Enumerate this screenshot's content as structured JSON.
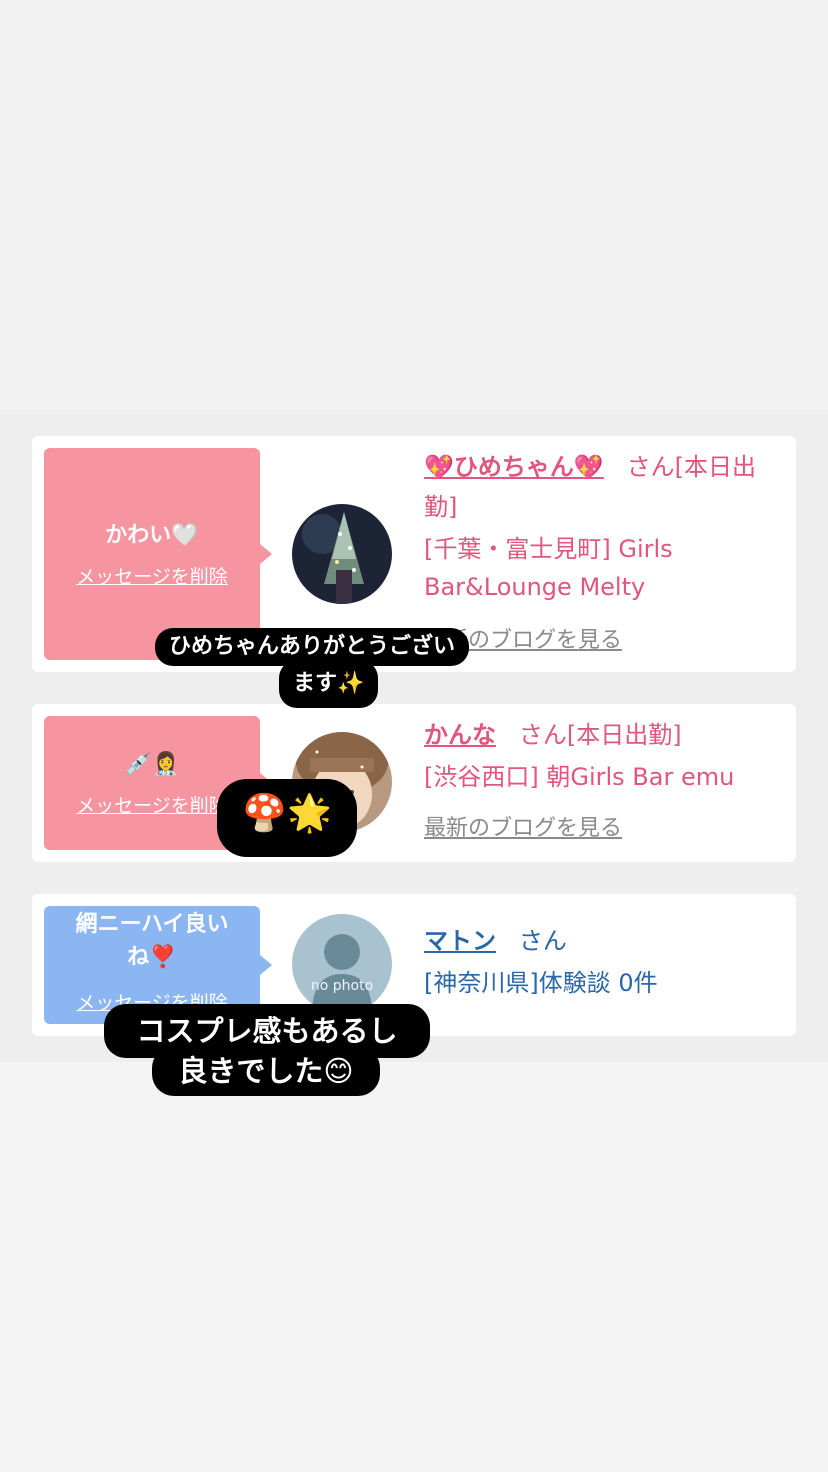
{
  "messages": [
    {
      "bubble_text": "かわい🤍",
      "delete_label": "メッセージを削除",
      "name": "💖ひめちゃん💖",
      "san": "さん[本日出",
      "san2": "勤]",
      "shop_line1": "[千葉・富士見町] Girls",
      "shop_line2": "Bar&Lounge Melty",
      "blog_link": "最新のブログを見る",
      "color": "#f6949f"
    },
    {
      "bubble_text": "💉👩‍⚕️",
      "delete_label": "メッセージを削除",
      "name": "かんな",
      "san": "さん[本日出勤]",
      "shop_line1": "[渋谷西口] 朝Girls Bar emu",
      "blog_link": "最新のブログを見る",
      "color": "#f6949f"
    },
    {
      "bubble_text_line1": "網ニーハイ良い",
      "bubble_text_line2": "ね❣️",
      "delete_label": "メッセージを削除",
      "name": "マトン",
      "san": "さん",
      "shop_line1": "[神奈川県]体験談 0件",
      "avatar_text": "no photo",
      "color": "#8bb6f2"
    }
  ],
  "captions": {
    "c1_line1": "ひめちゃんありがとうござい",
    "c1_line2": "ます✨",
    "c2": "🍄🌟",
    "c3_line1": "コスプレ感もあるし",
    "c3_line2": "良きでした😊"
  }
}
